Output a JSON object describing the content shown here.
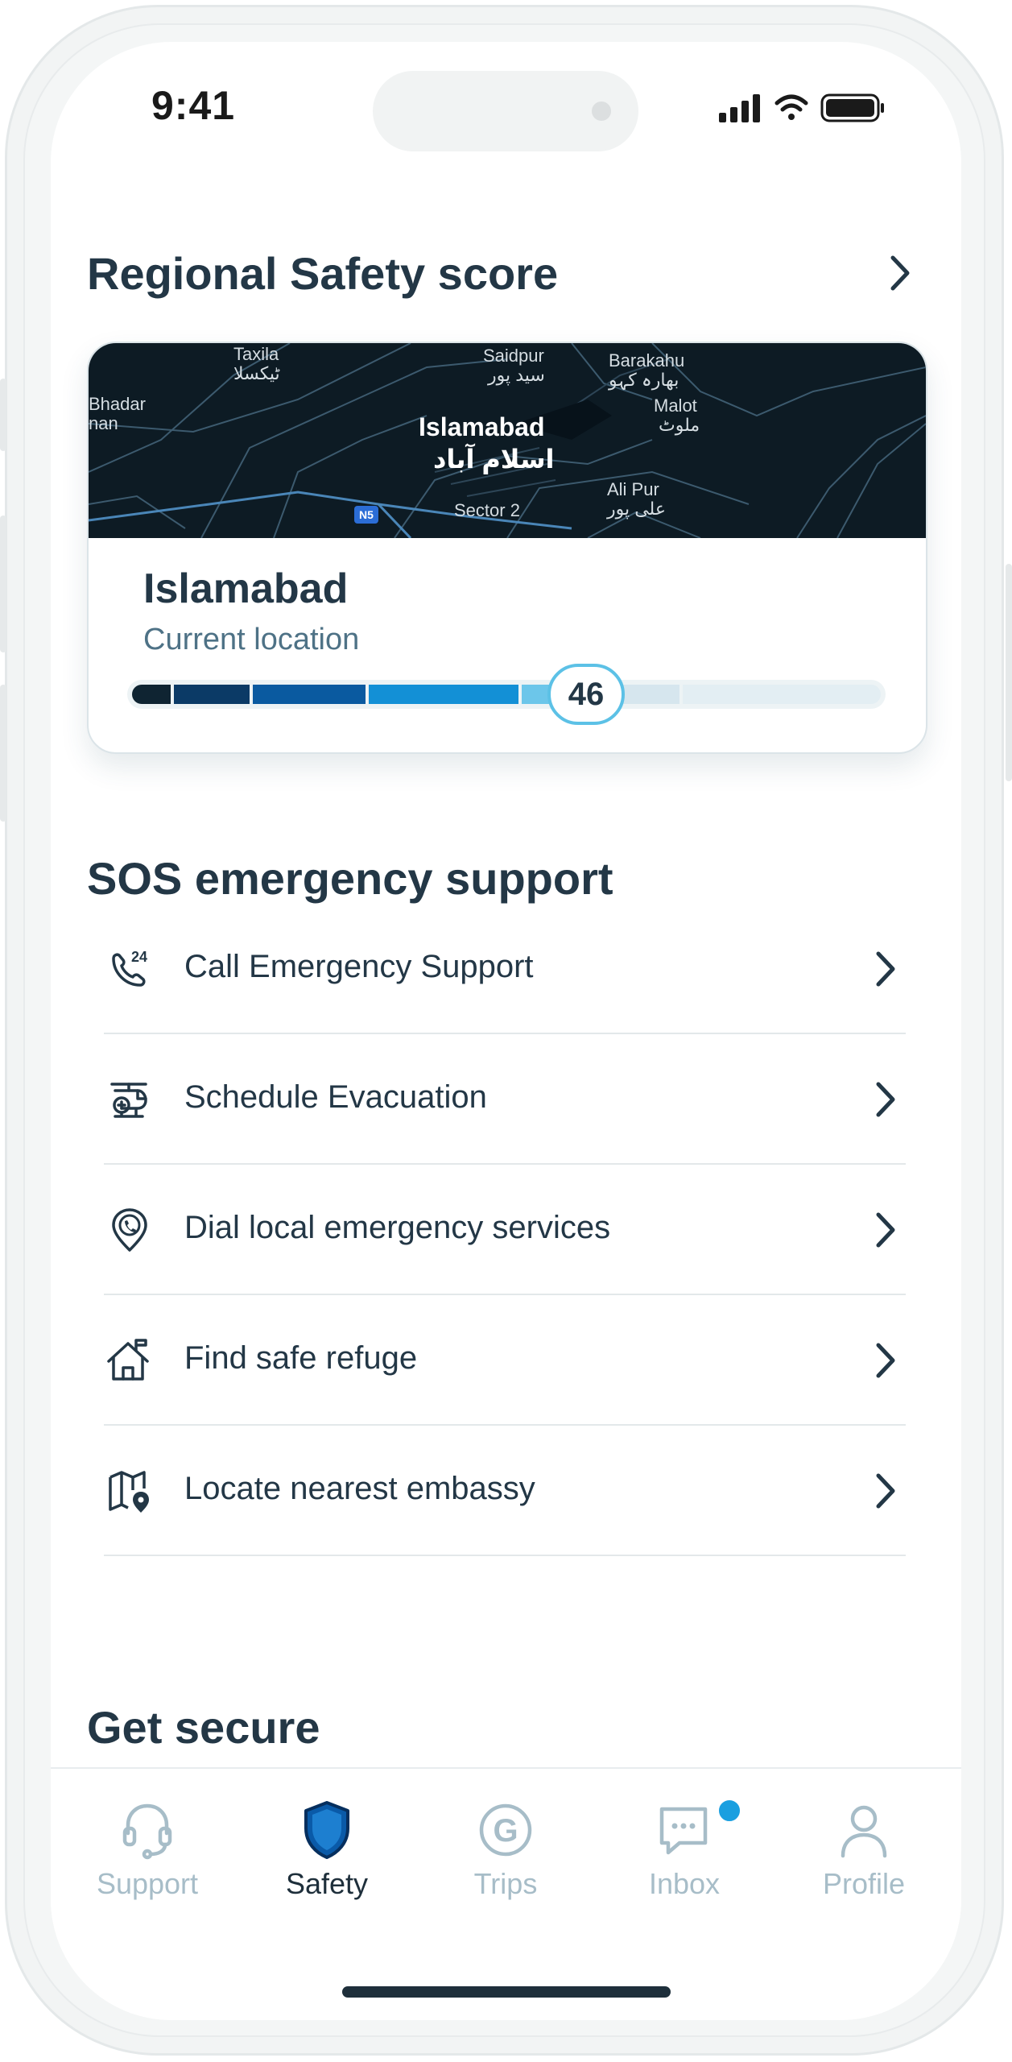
{
  "status_bar": {
    "time": "9:41"
  },
  "regional": {
    "title": "Regional Safety score",
    "city": "Islamabad",
    "subtitle": "Current location",
    "score": "46",
    "map_labels": {
      "taxila": "Taxila",
      "taxila_ur": "ٹیکسلا",
      "bhadar": "Bhadar",
      "nan": "nan",
      "saidpur": "Saidpur",
      "saidpur_ur": "سید پور",
      "barakahu": "Barakahu",
      "barakahu_ur": "بھارہ کہو",
      "malot": "Malot",
      "malot_ur": "ملوٹ",
      "islamabad": "Islamabad",
      "islamabad_ur": "اسلام آباد",
      "sector2": "Sector 2",
      "alipur": "Ali Pur",
      "alipur_ur": "علی پور",
      "n5": "N5"
    }
  },
  "sos": {
    "title": "SOS emergency support",
    "items": [
      {
        "label": "Call Emergency Support",
        "icon": "phone-24-icon"
      },
      {
        "label": "Schedule Evacuation",
        "icon": "helicopter-icon"
      },
      {
        "label": "Dial local emergency services",
        "icon": "location-phone-icon"
      },
      {
        "label": "Find safe refuge",
        "icon": "home-flag-icon"
      },
      {
        "label": "Locate nearest embassy",
        "icon": "map-pin-icon"
      }
    ]
  },
  "get_secure": {
    "title": "Get secure"
  },
  "tabs": [
    {
      "label": "Support",
      "icon": "headset-icon",
      "active": false
    },
    {
      "label": "Safety",
      "icon": "shield-icon",
      "active": true
    },
    {
      "label": "Trips",
      "icon": "g-circle-icon",
      "active": false
    },
    {
      "label": "Inbox",
      "icon": "chat-icon",
      "active": false,
      "badge": true
    },
    {
      "label": "Profile",
      "icon": "person-icon",
      "active": false
    }
  ],
  "colors": {
    "heading": "#233746",
    "accent": "#1a9fe0",
    "score_ring": "#5cc1e6",
    "tab_inactive": "#a7bdc8",
    "tab_active": "#0a5aa8"
  }
}
